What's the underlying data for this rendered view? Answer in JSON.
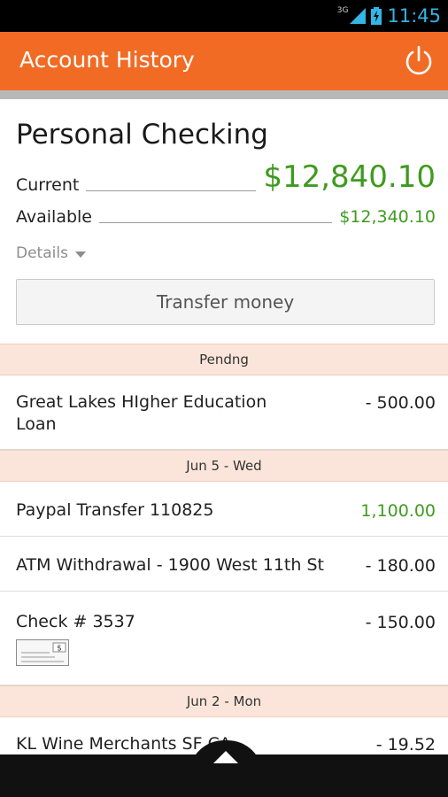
{
  "status_bar": {
    "network": "3G",
    "time": "11:45"
  },
  "action_bar": {
    "title": "Account History",
    "power_icon": "power-icon"
  },
  "account": {
    "name": "Personal Checking",
    "current_label": "Current",
    "current_value": "$12,840.10",
    "available_label": "Available",
    "available_value": "$12,340.10",
    "details_label": "Details"
  },
  "transfer_button": "Transfer money",
  "colors": {
    "accent": "#f26b24",
    "credit": "#3f9b1f",
    "section_bg": "#fbe5da"
  },
  "sections": [
    {
      "header": "Pendng",
      "transactions": [
        {
          "description": "Great Lakes HIgher Education Loan",
          "amount": "- 500.00"
        }
      ]
    },
    {
      "header": "Jun 5 - Wed",
      "transactions": [
        {
          "description": "Paypal Transfer 110825",
          "amount": "1,100.00"
        },
        {
          "description": "ATM Withdrawal - 1900 West 11th St",
          "amount": "- 180.00"
        },
        {
          "description": "Check # 3537",
          "amount": "- 150.00"
        }
      ]
    },
    {
      "header": "Jun 2 - Mon",
      "transactions": [
        {
          "description": "KL Wine Merchants SF CA",
          "amount": "- 19.52"
        }
      ]
    }
  ]
}
